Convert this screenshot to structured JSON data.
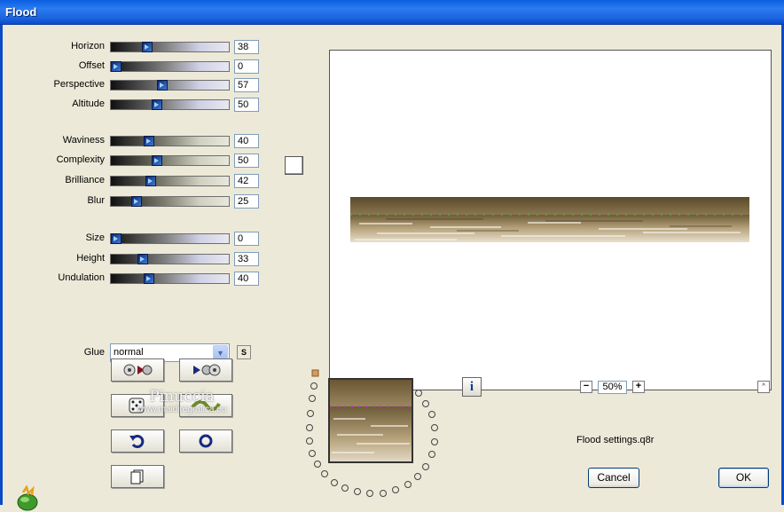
{
  "window": {
    "title": "Flood"
  },
  "sliders": [
    {
      "label": "Horizon",
      "value": "38",
      "level": 38
    },
    {
      "label": "Offset",
      "value": "0",
      "level": 0
    },
    {
      "label": "Perspective",
      "value": "57",
      "level": 57
    },
    {
      "label": "Altitude",
      "value": "50",
      "level": 50
    },
    {
      "label": "Waviness",
      "value": "40",
      "level": 40
    },
    {
      "label": "Complexity",
      "value": "50",
      "level": 50
    },
    {
      "label": "Brilliance",
      "value": "42",
      "level": 42
    },
    {
      "label": "Blur",
      "value": "25",
      "level": 25
    },
    {
      "label": "Size",
      "value": "0",
      "level": 0
    },
    {
      "label": "Height",
      "value": "33",
      "level": 33
    },
    {
      "label": "Undulation",
      "value": "40",
      "level": 40
    }
  ],
  "glue": {
    "label": "Glue",
    "selected": "normal",
    "side_button": "S"
  },
  "colors": {
    "titlebar": "#0a5fe0",
    "dialog_bg": "#ece9d8",
    "swatch": "#ffffff",
    "water_dark": "#5f4d2c",
    "water_light": "#a9956c"
  },
  "tool_buttons": [
    {
      "icon": "load-preset-icon"
    },
    {
      "icon": "save-preset-icon"
    },
    {
      "icon": "random-dice-icon"
    },
    {
      "icon": "wave-icon"
    },
    {
      "icon": "reset-undo-icon"
    },
    {
      "icon": "stop-circle-icon"
    },
    {
      "icon": "copy-pages-icon"
    }
  ],
  "watermark": {
    "name": "Pinuccia",
    "url": "www.maidiregrafica.eu"
  },
  "zoom": {
    "minus": "−",
    "value": "50%",
    "plus": "+"
  },
  "info_button": "i",
  "collapse_button": "^",
  "settings_file": "Flood settings.q8r",
  "buttons": {
    "cancel": "Cancel",
    "ok": "OK"
  }
}
